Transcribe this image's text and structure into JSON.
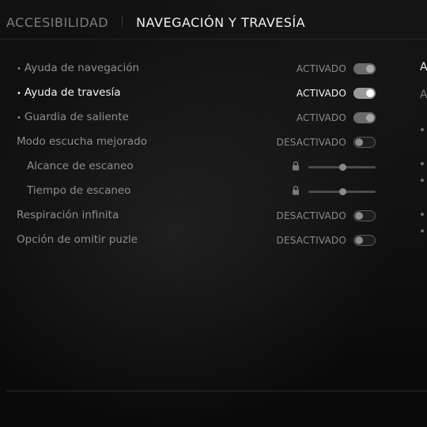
{
  "tabs": [
    {
      "label": "ACCESIBILIDAD"
    },
    {
      "label": "NAVEGACIÓN Y TRAVESÍA"
    }
  ],
  "settings": [
    {
      "label": "Ayuda de navegación",
      "value": "ACTIVADO"
    },
    {
      "label": "Ayuda de travesía",
      "value": "ACTIVADO"
    },
    {
      "label": "Guardia de saliente",
      "value": "ACTIVADO"
    },
    {
      "label": "Modo escucha mejorado",
      "value": "DESACTIVADO"
    },
    {
      "label": "Alcance de escaneo",
      "level": 0.5
    },
    {
      "label": "Tiempo de escaneo",
      "level": 0.5
    },
    {
      "label": "Respiración infinita",
      "value": "DESACTIVADO"
    },
    {
      "label": "Opción de omitir puzle",
      "value": "DESACTIVADO"
    }
  ],
  "bullet": "•",
  "right_panel": {
    "title": "A",
    "subtitle": "A"
  }
}
